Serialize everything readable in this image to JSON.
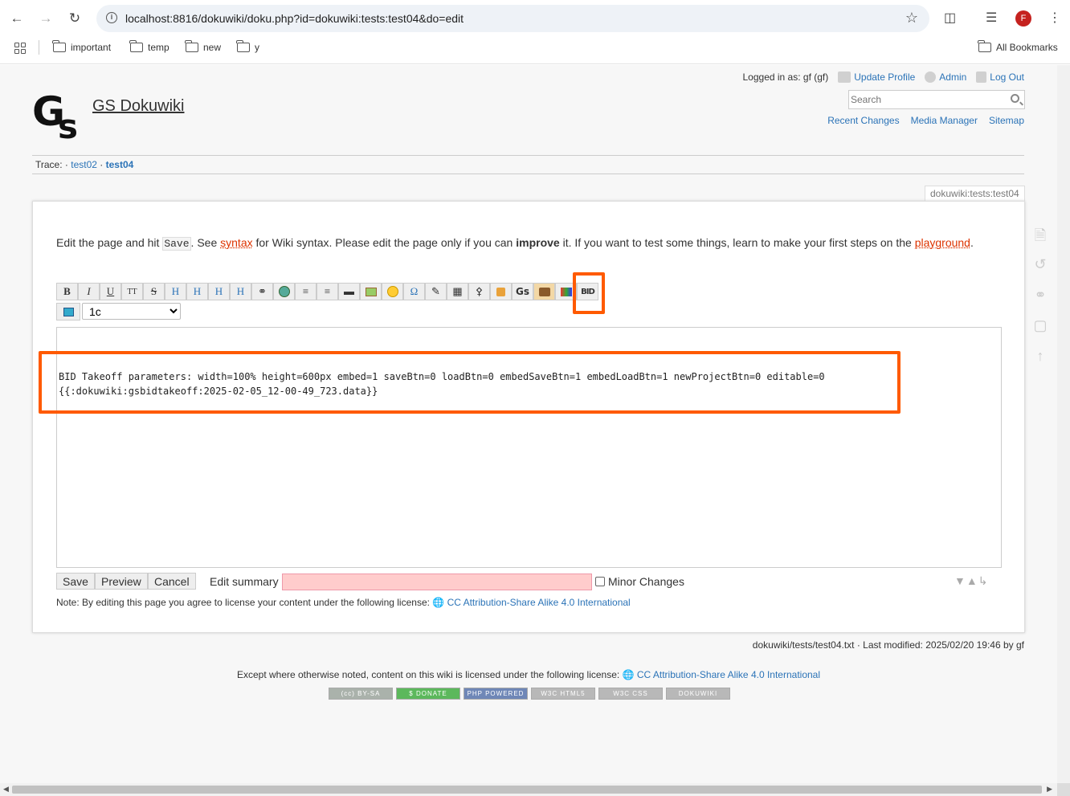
{
  "browser": {
    "url": "localhost:8816/dokuwiki/doku.php?id=dokuwiki:tests:test04&do=edit",
    "avatar_letter": "F",
    "bookmarks": [
      "important",
      "temp",
      "new",
      "y"
    ],
    "all_bookmarks": "All Bookmarks"
  },
  "header": {
    "site_name": "GS Dokuwiki",
    "logged_in": "Logged in as: gf (gf)",
    "update_profile": "Update Profile",
    "admin": "Admin",
    "log_out": "Log Out",
    "search_placeholder": "Search",
    "recent_changes": "Recent Changes",
    "media_manager": "Media Manager",
    "sitemap": "Sitemap"
  },
  "trace": {
    "label": "Trace:",
    "items": [
      "test02",
      "test04"
    ]
  },
  "page_id": "dokuwiki:tests:test04",
  "intro": {
    "t1": "Edit the page and hit ",
    "save_code": "Save",
    "t2": ". See ",
    "syntax_link": "syntax",
    "t3": " for Wiki syntax. Please edit the page only if you can ",
    "improve": "improve",
    "t4": " it. If you want to test some things, learn to make your first steps on the ",
    "playground_link": "playground",
    "t5": "."
  },
  "toolbar": {
    "buttons": [
      "B",
      "I",
      "U",
      "TT",
      "S",
      "H",
      "H",
      "H",
      "H",
      "link",
      "www",
      "ol",
      "ul",
      "hr",
      "img",
      "smiley",
      "Ω",
      "sig",
      "table",
      "key",
      "lock",
      "Gs",
      "bag",
      "color",
      "BID"
    ],
    "column_select_value": "1c"
  },
  "editor": {
    "line1": "BID Takeoff parameters: width=100% height=600px embed=1 saveBtn=0 loadBtn=0 embedSaveBtn=1 embedLoadBtn=1 newProjectBtn=0 editable=0",
    "line2": "{{:dokuwiki:gsbidtakeoff:2025-02-05_12-00-49_723.data}}"
  },
  "form": {
    "save": "Save",
    "preview": "Preview",
    "cancel": "Cancel",
    "edit_summary": "Edit summary",
    "minor_changes": "Minor Changes",
    "note_text": "Note: By editing this page you agree to license your content under the following license:",
    "license_link": "CC Attribution-Share Alike 4.0 International"
  },
  "footer": {
    "docinfo": "dokuwiki/tests/test04.txt · Last modified: 2025/02/20 19:46 by gf",
    "license_text": "Except where otherwise noted, content on this wiki is licensed under the following license:",
    "license_link": "CC Attribution-Share Alike 4.0 International",
    "badges": [
      "(cc) BY-SA",
      "$ DONATE",
      "PHP POWERED",
      "W3C HTML5",
      "W3C CSS",
      "DOKUWIKI"
    ],
    "badge_colors": [
      "#aab2ab",
      "#5cb85c",
      "#6f87b7",
      "#b8b8b8",
      "#b8b8b8",
      "#b8b8b8"
    ]
  },
  "colors": {
    "link": "#2b73b7",
    "highlight_box": "#ff5a00",
    "summary_bg": "#ffcccc"
  }
}
